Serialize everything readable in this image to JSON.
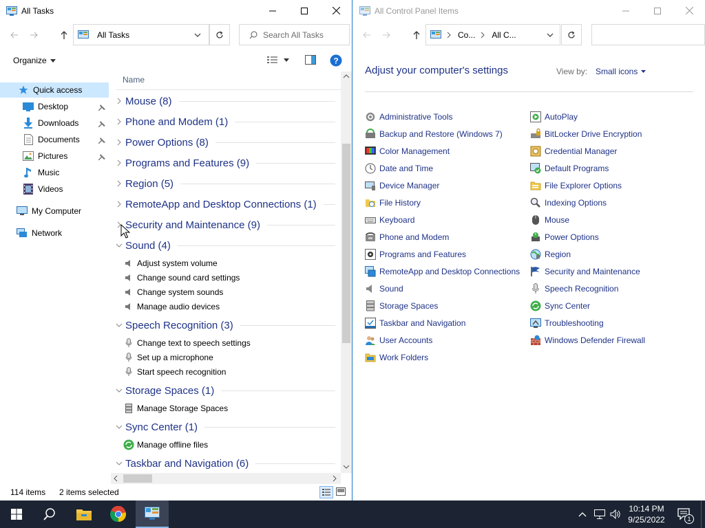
{
  "left_window": {
    "title": "All Tasks",
    "address": "All Tasks",
    "search_placeholder": "Search All Tasks",
    "organize_label": "Organize",
    "column_header": "Name",
    "nav": {
      "quick_access": "Quick access",
      "items": [
        "Desktop",
        "Downloads",
        "Documents",
        "Pictures",
        "Music",
        "Videos"
      ],
      "my_computer": "My Computer",
      "network": "Network"
    },
    "groups": {
      "g0": "Mouse (8)",
      "g1": "Phone and Modem (1)",
      "g2": "Power Options (8)",
      "g3": "Programs and Features (9)",
      "g4": "Region (5)",
      "g5": "RemoteApp and Desktop Connections (1)",
      "g6": "Security and Maintenance (9)",
      "g7": "Sound (4)",
      "g8": "Speech Recognition (3)",
      "g9": "Storage Spaces (1)",
      "g10": "Sync Center (1)",
      "g11": "Taskbar and Navigation (6)"
    },
    "sound_tasks": [
      "Adjust system volume",
      "Change sound card settings",
      "Change system sounds",
      "Manage audio devices"
    ],
    "speech_tasks": [
      "Change text to speech settings",
      "Set up a microphone",
      "Start speech recognition"
    ],
    "storage_tasks": [
      "Manage Storage Spaces"
    ],
    "sync_tasks": [
      "Manage offline files"
    ],
    "status_count": "114 items",
    "status_selected": "2 items selected"
  },
  "right_window": {
    "title": "All Control Panel Items",
    "crumb1": "Co...",
    "crumb2": "All C...",
    "heading": "Adjust your computer's settings",
    "view_by_label": "View by:",
    "view_by_value": "Small icons",
    "col1": [
      "Administrative Tools",
      "Backup and Restore (Windows 7)",
      "Color Management",
      "Date and Time",
      "Device Manager",
      "File History",
      "Keyboard",
      "Phone and Modem",
      "Programs and Features",
      "RemoteApp and Desktop Connections",
      "Sound",
      "Storage Spaces",
      "Taskbar and Navigation",
      "User Accounts",
      "Work Folders"
    ],
    "col2": [
      "AutoPlay",
      "BitLocker Drive Encryption",
      "Credential Manager",
      "Default Programs",
      "File Explorer Options",
      "Indexing Options",
      "Mouse",
      "Power Options",
      "Region",
      "Security and Maintenance",
      "Speech Recognition",
      "Sync Center",
      "Troubleshooting",
      "Windows Defender Firewall"
    ]
  },
  "taskbar": {
    "time": "10:14 PM",
    "date": "9/25/2022",
    "notification_count": "1"
  },
  "colors": {
    "link": "#1e3287",
    "taskbar": "#1c2433",
    "selection": "#cce8ff",
    "accent": "#0078d7"
  }
}
